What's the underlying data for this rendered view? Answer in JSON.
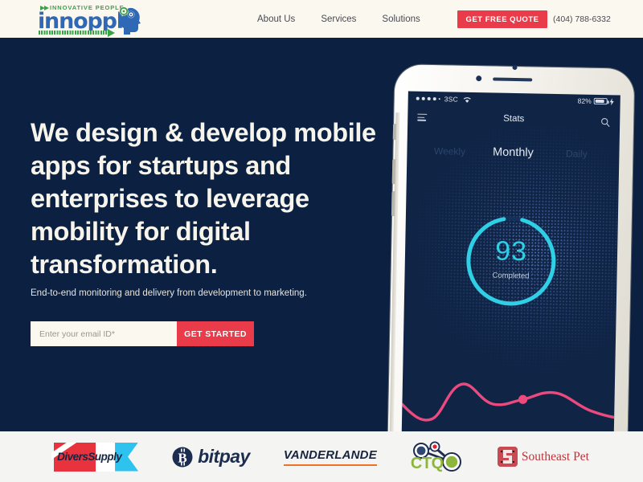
{
  "header": {
    "logo": {
      "tagline": "INNOVATIVE PEOPLE",
      "wordmark": "innoppl",
      "icon": "head-gears-icon"
    },
    "nav": [
      {
        "label": "About Us"
      },
      {
        "label": "Services"
      },
      {
        "label": "Solutions"
      }
    ],
    "quote_button": "GET FREE QUOTE",
    "phone": "(404) 788-6332"
  },
  "hero": {
    "headline": "We design & develop mobile apps for startups and enterprises to leverage mobility for digital transformation.",
    "subheadline": "End-to-end monitoring and delivery from development to marketing.",
    "email_placeholder": "Enter your email ID*",
    "email_value": "",
    "cta_label": "GET STARTED",
    "bg_color": "#0c2141",
    "accent_color": "#ea3b4a"
  },
  "phone_app": {
    "status": {
      "signal_dots": 5,
      "signal_filled": 4,
      "carrier": "3SC",
      "wifi": "wifi-icon",
      "battery_percent": "82%",
      "battery_level": 82,
      "charging": true
    },
    "app_bar": {
      "menu_icon": "hamburger-menu-icon",
      "title": "Stats",
      "search_icon": "search-icon"
    },
    "tabs": [
      {
        "label": "Weekly",
        "active": false
      },
      {
        "label": "Monthly",
        "active": true
      },
      {
        "label": "Daily",
        "active": false
      }
    ],
    "progress": {
      "value": "93",
      "label": "Completed",
      "percent": 93,
      "ring_color": "#2fcfe6",
      "track_color": "#143059"
    },
    "chart_line_color": "#ec4a7e"
  },
  "chart_data": {
    "type": "line",
    "title": "Stats",
    "series": [
      {
        "name": "Monthly",
        "x": [
          0,
          10,
          20,
          30,
          40,
          50,
          58,
          66,
          75,
          85,
          100
        ],
        "values": [
          42,
          20,
          14,
          42,
          66,
          52,
          46,
          47,
          58,
          62,
          46
        ]
      }
    ],
    "highlight_point": {
      "x": 58,
      "y": 49
    },
    "xlabel": "",
    "ylabel": "",
    "grid": false,
    "legend": "none"
  },
  "clients": [
    {
      "name": "Divers Supply",
      "text": "DiversSupply"
    },
    {
      "name": "BitPay",
      "text": "bitpay",
      "icon": "bitcoin-icon"
    },
    {
      "name": "Vanderlande",
      "text": "VANDERLANDE"
    },
    {
      "name": "CTQ",
      "text": "CTQ",
      "icon": "ctq-nodes-icon"
    },
    {
      "name": "Southeast Pet",
      "text": "Southeast Pet",
      "icon": "southeast-pet-mark"
    }
  ]
}
